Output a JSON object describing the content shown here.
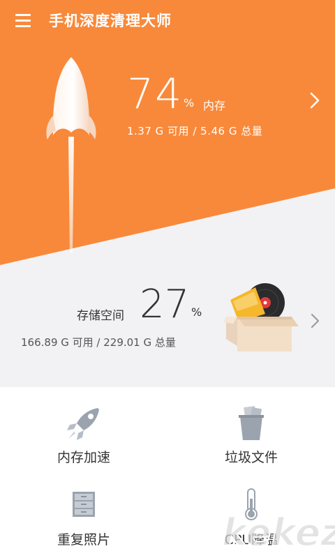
{
  "app": {
    "title": "手机深度清理大师"
  },
  "colors": {
    "primary": "#f8893a",
    "secondary_bg": "#f2f2f4",
    "text_dark": "#333333",
    "icon_gray": "#9aa3ae"
  },
  "memory": {
    "percent": "74",
    "percent_unit": "%",
    "label": "内存",
    "detail": "1.37 G 可用 / 5.46 G 总量",
    "fill_fraction": 0.74
  },
  "storage": {
    "label": "存储空间",
    "percent": "27",
    "percent_unit": "%",
    "detail": "166.89 G 可用 / 229.01 G 总量",
    "fill_fraction": 0.27
  },
  "tools": [
    {
      "label": "内存加速",
      "icon": "rocket-icon"
    },
    {
      "label": "垃圾文件",
      "icon": "trash-bin-icon"
    },
    {
      "label": "重复照片",
      "icon": "cabinet-icon"
    },
    {
      "label": "CPU降温",
      "icon": "thermometer-icon"
    }
  ],
  "watermark": {
    "text": "kekez"
  }
}
